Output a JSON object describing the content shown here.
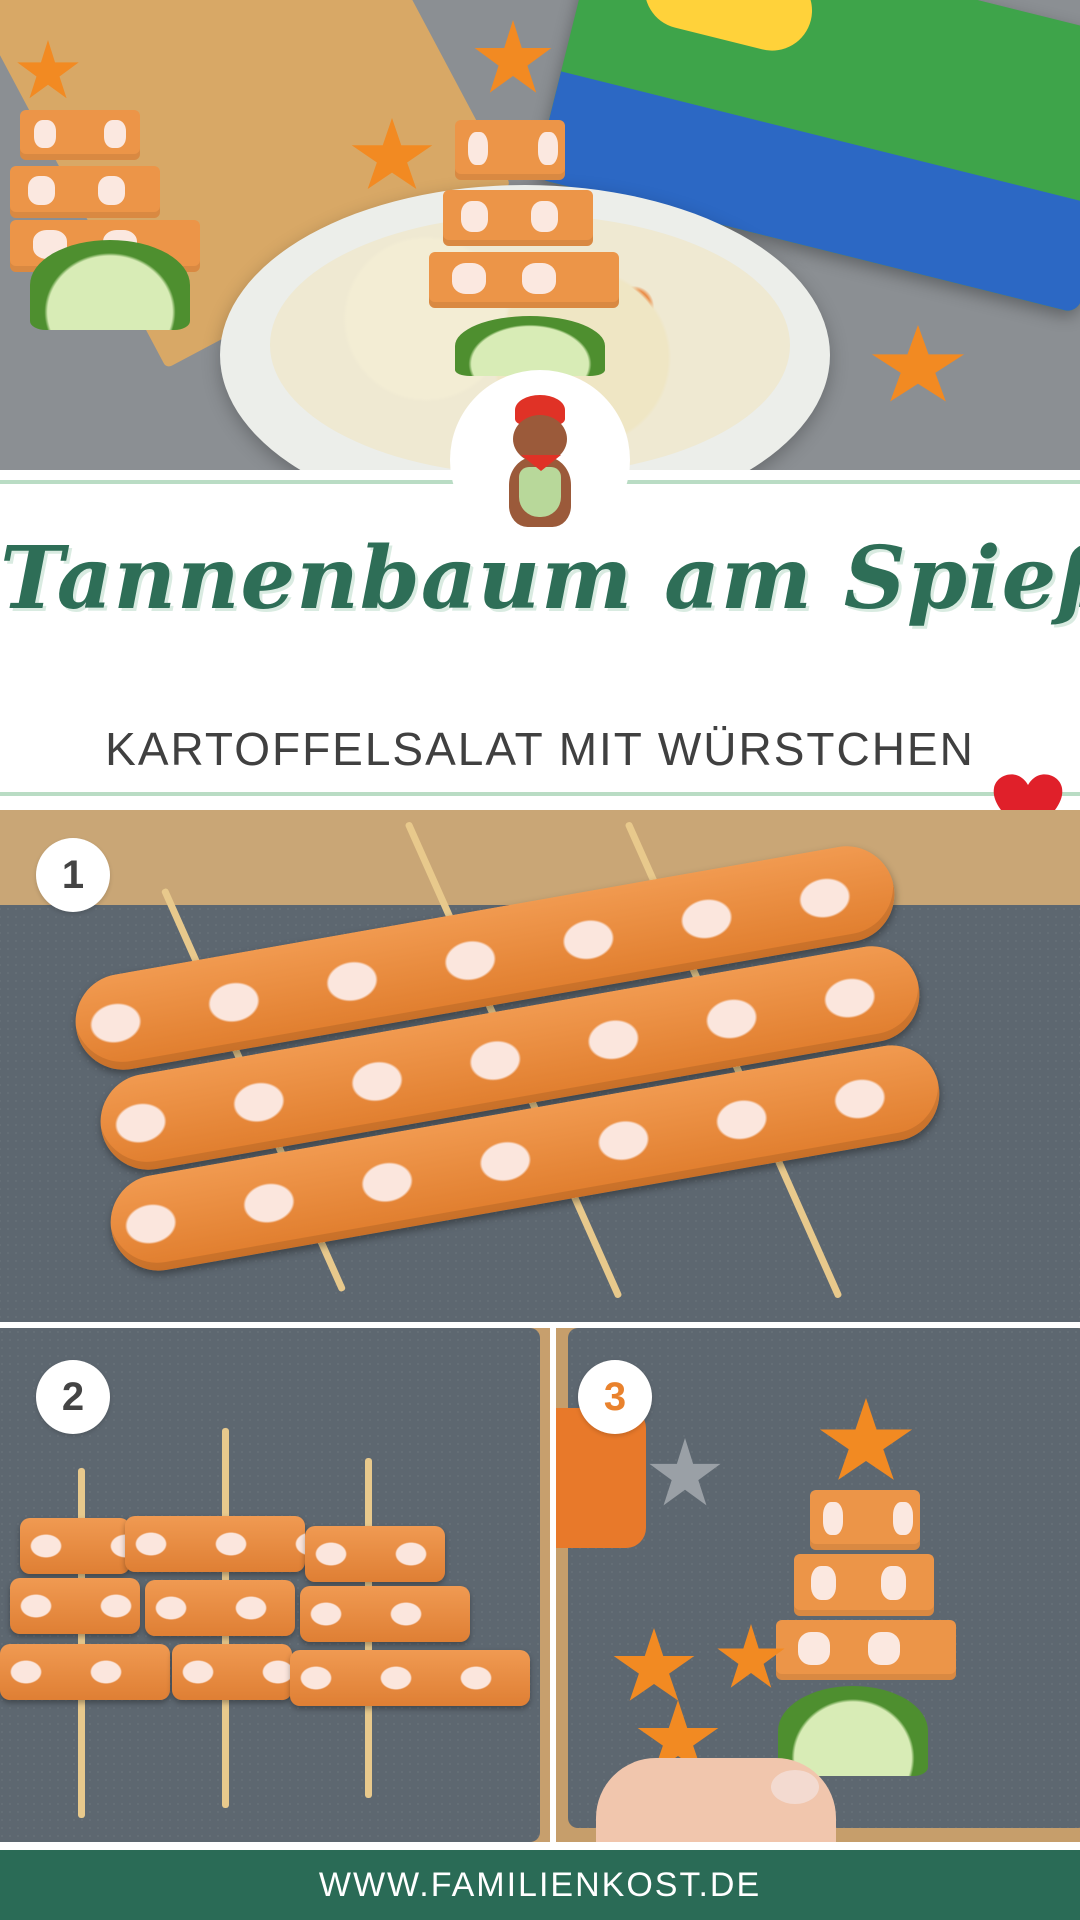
{
  "title": "Tannenbaum am Spieß",
  "subtitle": "KARTOFFELSALAT MIT WÜRSTCHEN",
  "steps": [
    {
      "number": "1"
    },
    {
      "number": "2"
    },
    {
      "number": "3"
    }
  ],
  "footer": {
    "url": "WWW.FAMILIENKOST.DE"
  },
  "icons": {
    "heart": "heart-icon",
    "mascot": "bear-mascot-icon"
  },
  "colors": {
    "brand_green": "#2a6b56",
    "title_green": "#2e6e57",
    "accent_orange": "#e9822d",
    "heart_red": "#e0202a"
  }
}
